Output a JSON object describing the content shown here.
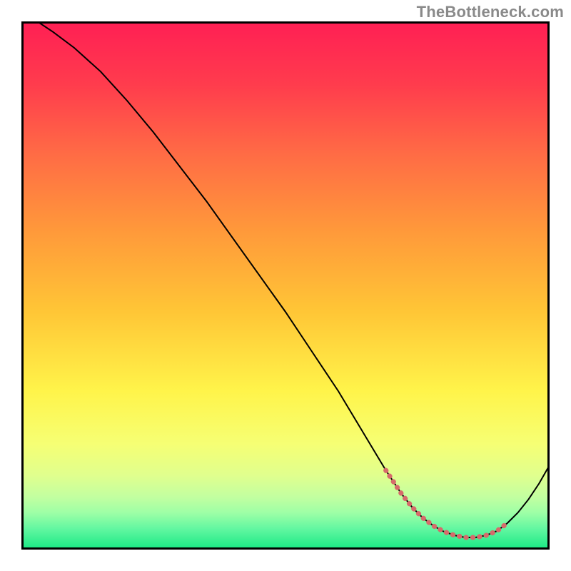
{
  "attribution": "TheBottleneck.com",
  "chart_data": {
    "type": "line",
    "title": "",
    "xlabel": "",
    "ylabel": "",
    "xlim": [
      0,
      100
    ],
    "ylim": [
      0,
      100
    ],
    "grid": false,
    "legend": false,
    "series": [
      {
        "name": "main-curve",
        "color": "#000000",
        "stroke_width": 2,
        "x": [
          3,
          6,
          10,
          15,
          20,
          25,
          30,
          35,
          40,
          45,
          50,
          55,
          60,
          63,
          66,
          69,
          72,
          74,
          76,
          78,
          80,
          82,
          84,
          86,
          88,
          90,
          92,
          94,
          96,
          98,
          100
        ],
        "y": [
          100,
          98,
          95,
          90.5,
          85,
          79,
          72.5,
          66,
          59,
          52,
          45,
          37.5,
          30,
          25,
          20,
          15,
          10.5,
          8,
          6,
          4.5,
          3.4,
          2.7,
          2.3,
          2.3,
          2.7,
          3.5,
          5,
          7,
          9.5,
          12.5,
          16
        ]
      },
      {
        "name": "highlight-segment",
        "color": "#d66b6b",
        "stroke_width": 7,
        "stroke_dasharray": "0.5 9",
        "stroke_linecap": "round",
        "x": [
          69,
          72,
          74,
          76,
          78,
          80,
          82,
          84,
          86,
          88,
          90,
          92
        ],
        "y": [
          15,
          10.5,
          8,
          6,
          4.5,
          3.4,
          2.7,
          2.3,
          2.3,
          2.7,
          3.5,
          5
        ]
      }
    ],
    "background_gradient": {
      "stops": [
        {
          "offset": 0.0,
          "color": "#ff1f54"
        },
        {
          "offset": 0.12,
          "color": "#ff3c4d"
        },
        {
          "offset": 0.25,
          "color": "#ff6b45"
        },
        {
          "offset": 0.4,
          "color": "#ff9a3a"
        },
        {
          "offset": 0.55,
          "color": "#ffc636"
        },
        {
          "offset": 0.7,
          "color": "#fff44a"
        },
        {
          "offset": 0.8,
          "color": "#f6ff74"
        },
        {
          "offset": 0.86,
          "color": "#e0ff8e"
        },
        {
          "offset": 0.9,
          "color": "#c3ffa0"
        },
        {
          "offset": 0.93,
          "color": "#9effa6"
        },
        {
          "offset": 0.96,
          "color": "#63f7a1"
        },
        {
          "offset": 1.0,
          "color": "#17e884"
        }
      ]
    }
  }
}
